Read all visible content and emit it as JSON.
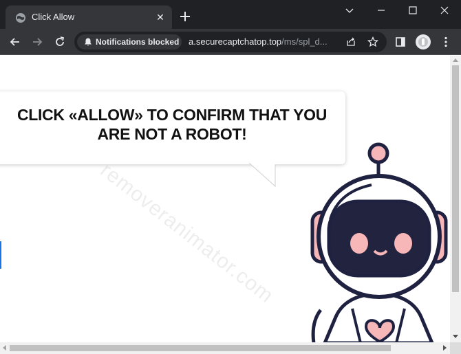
{
  "tab": {
    "title": "Click Allow",
    "close_glyph": "✕",
    "favicon": "globe-icon"
  },
  "toolbar": {
    "permission_chip": "Notifications blocked",
    "url_host": "a.securecaptchatop.top",
    "url_path": "/ms/spl_d..."
  },
  "page": {
    "headline_line1": "CLICK «ALLOW» TO CONFIRM THAT YOU",
    "headline_line2": "ARE NOT A ROBOT!",
    "watermark": "removeranimator.com"
  },
  "colors": {
    "chrome_dark": "#202124",
    "chrome_mid": "#35363a",
    "robot_outline": "#1f2140",
    "robot_pink": "#f7b6b8",
    "robot_face": "#22243f"
  },
  "icons": [
    "globe-icon",
    "close-icon",
    "new-tab-icon",
    "chevron-down-icon",
    "minimize-icon",
    "maximize-icon",
    "close-window-icon",
    "back-icon",
    "forward-icon",
    "reload-icon",
    "bell-icon",
    "share-icon",
    "star-icon",
    "side-panel-icon",
    "avatar",
    "kebab-menu-icon"
  ]
}
